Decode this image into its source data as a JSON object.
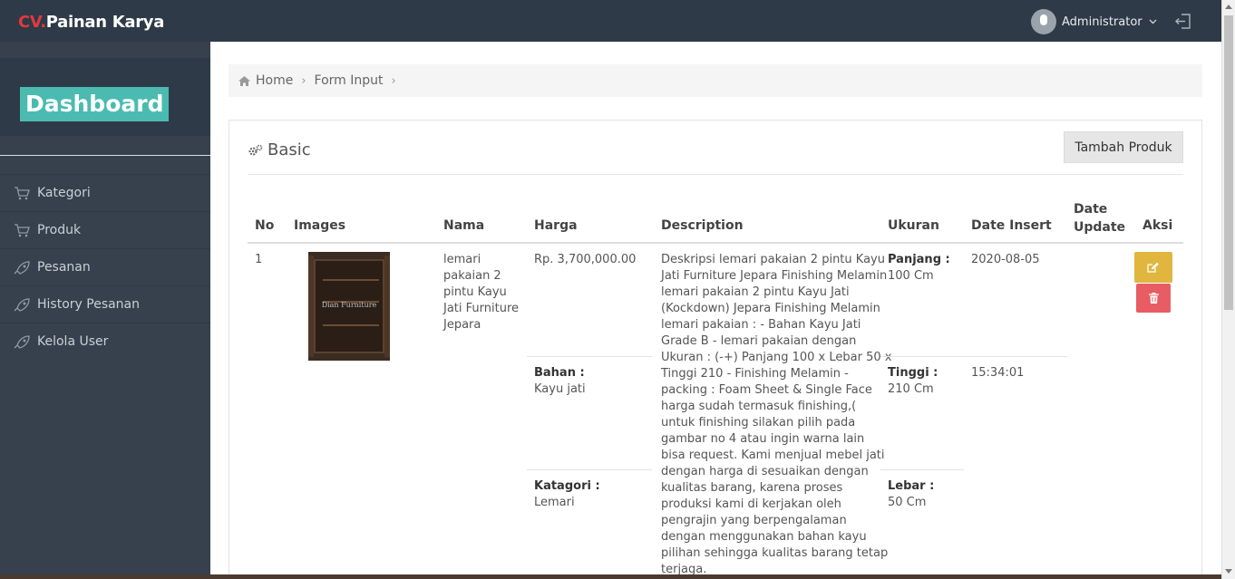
{
  "topbar": {
    "brand_prefix": "CV.",
    "brand_name": "Painan Karya",
    "user_name": "Administrator"
  },
  "sidebar": {
    "title": "Dashboard",
    "items": [
      {
        "label": "Kategori",
        "icon": "cart-icon"
      },
      {
        "label": "Produk",
        "icon": "cart-icon"
      },
      {
        "label": "Pesanan",
        "icon": "rocket-icon"
      },
      {
        "label": "History Pesanan",
        "icon": "rocket-icon"
      },
      {
        "label": "Kelola User",
        "icon": "rocket-icon"
      }
    ]
  },
  "breadcrumb": {
    "home": "Home",
    "current": "Form Input"
  },
  "panel": {
    "title": "Basic",
    "add_button": "Tambah Produk"
  },
  "table": {
    "headers": {
      "no": "No",
      "images": "Images",
      "nama": "Nama",
      "harga": "Harga",
      "description": "Description",
      "ukuran": "Ukuran",
      "date_insert": "Date Insert",
      "date_update_1": "Date",
      "date_update_2": "Update",
      "aksi": "Aksi"
    },
    "row": {
      "no": "1",
      "image_watermark": "Dian Furniture",
      "nama_lines": [
        "lemari",
        "pakaian 2",
        "pintu Kayu",
        "Jati Furniture",
        "Jepara"
      ],
      "harga": "Rp. 3,700,000.00",
      "bahan_label": "Bahan :",
      "bahan_value": "Kayu jati",
      "kategori_label": "Katagori :",
      "kategori_value": "Lemari",
      "description_lines": [
        "Deskripsi lemari pakaian 2 pintu Kayu",
        "Jati Furniture Jepara Finishing Melamin",
        "lemari pakaian 2 pintu Kayu Jati",
        "(Kockdown) Jepara Finishing Melamin",
        "lemari pakaian : - Bahan Kayu Jati",
        "Grade B - lemari pakaian dengan",
        "Ukuran : (-+) Panjang 100 x Lebar 50 x",
        "Tinggi 210 - Finishing Melamin -",
        "packing : Foam Sheet & Single Face",
        "harga sudah termasuk finishing,(",
        "untuk finishing silakan pilih pada",
        "gambar no 4 atau ingin warna lain",
        "bisa request. Kami menjual mebel jati",
        "dengan harga di sesuaikan dengan",
        "kualitas barang, karena proses",
        "produksi kami di kerjakan oleh",
        "pengrajin yang berpengalaman",
        "dengan menggunakan bahan kayu",
        "pilihan sehingga kualitas barang tetap",
        "terjaga."
      ],
      "panjang_label": "Panjang :",
      "panjang_value": "100 Cm",
      "tinggi_label": "Tinggi :",
      "tinggi_value": "210 Cm",
      "lebar_label": "Lebar :",
      "lebar_value": "50 Cm",
      "date_insert": "2020-08-05",
      "time_insert": "15:34:01"
    }
  },
  "colors": {
    "topbar": "#2e3a47",
    "sidebar": "#36414d",
    "dashboard_badge": "#4bbbb1",
    "brand_accent": "#e2383f",
    "edit_button": "#e0b63f",
    "delete_button": "#e85d63"
  }
}
